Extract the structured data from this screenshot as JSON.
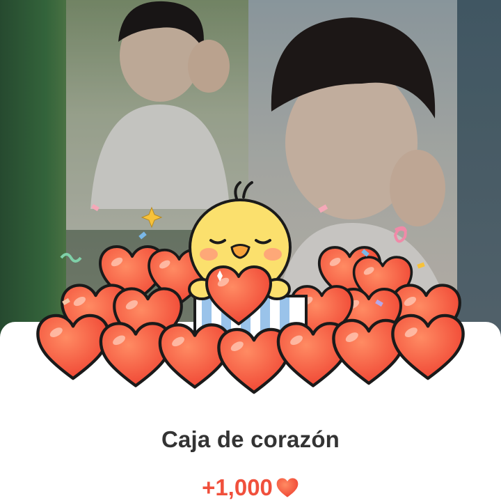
{
  "reward_card": {
    "title": "Caja de corazón",
    "amount": "+1,000",
    "amount_icon": "heart-icon"
  },
  "colors": {
    "amount": "#f0503c",
    "title": "#333333",
    "heart": "#f5583f",
    "card_background": "#ffffff"
  },
  "illustration": {
    "character": "yellow-chick",
    "items": [
      "heart-pile",
      "gift-box",
      "confetti"
    ]
  }
}
